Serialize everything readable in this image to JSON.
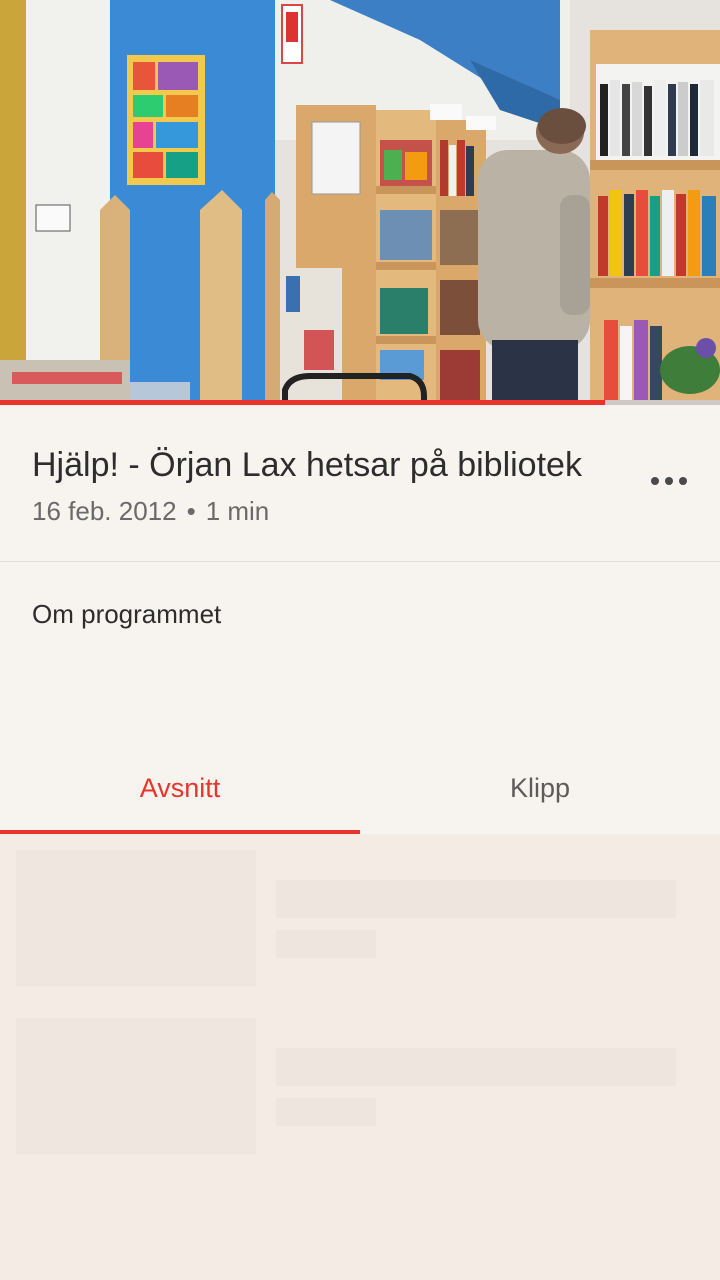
{
  "player": {
    "progress_fraction": 0.84
  },
  "program": {
    "title": "Hjälp! - Örjan Lax hetsar på bibliotek",
    "date": "16 feb. 2012",
    "separator": "•",
    "duration": "1 min",
    "more_icon": "more-horizontal-icon"
  },
  "about": {
    "label": "Om programmet"
  },
  "tabs": [
    {
      "label": "Avsnitt",
      "active": true
    },
    {
      "label": "Klipp",
      "active": false
    }
  ],
  "list": {
    "loading_placeholders": 2
  },
  "colors": {
    "accent": "#e8342a",
    "background": "#f3ebe4",
    "surface": "#f7f3ef",
    "skeleton": "#efe6e0",
    "text_primary": "#2d2d2d",
    "text_secondary": "#6a6a6a"
  }
}
